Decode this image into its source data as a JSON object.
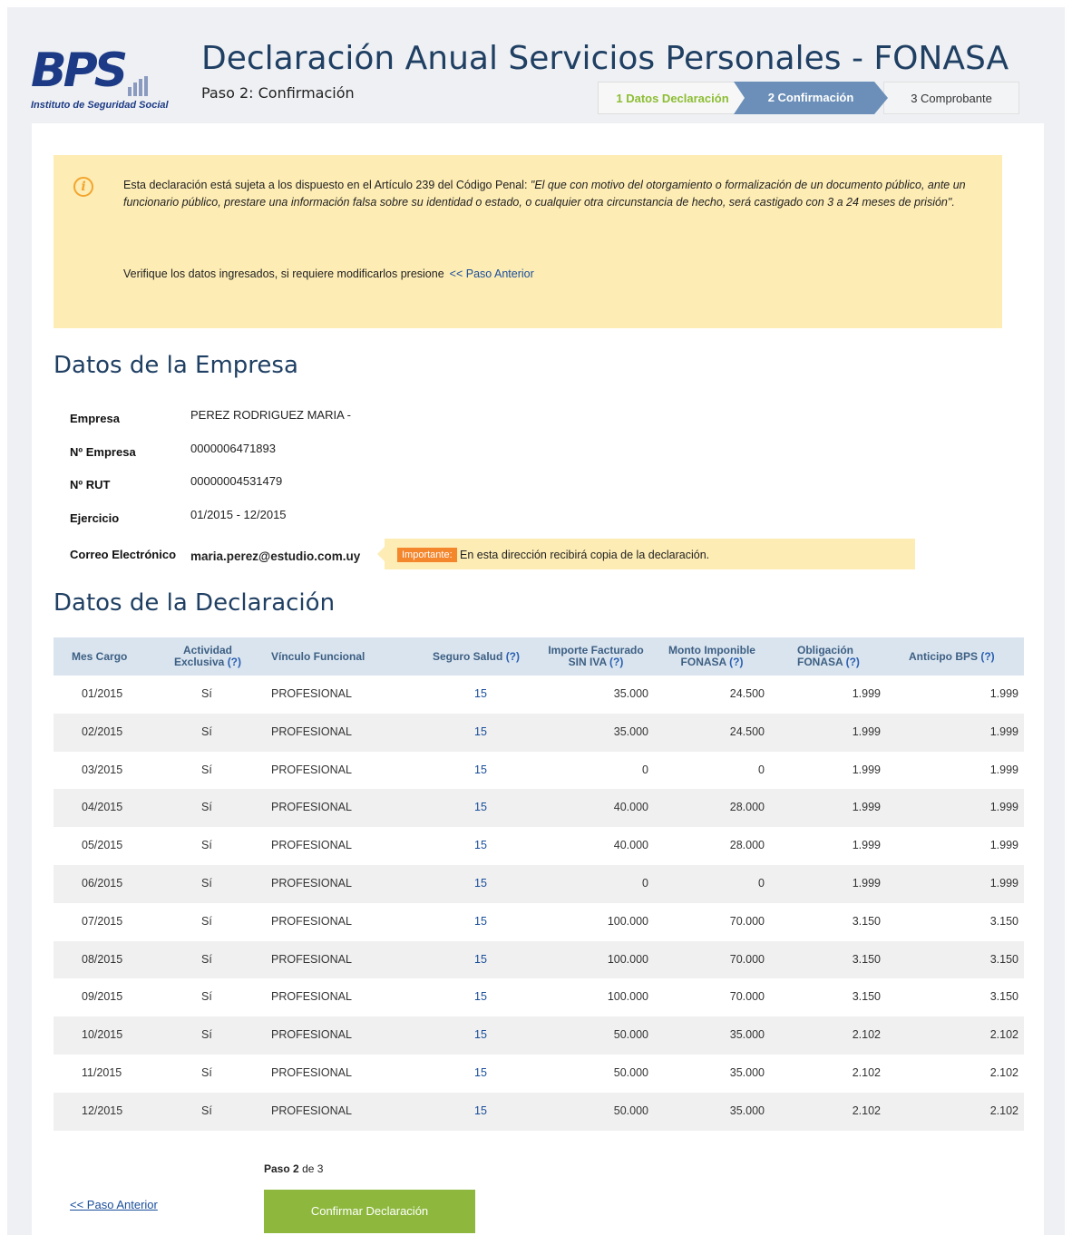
{
  "header": {
    "logo_text": "BPS",
    "logo_caption": "Instituto de Seguridad Social",
    "title": "Declaración Anual Servicios Personales - FONASA",
    "subtitle": "Paso 2: Confirmación",
    "steps": [
      "1 Datos Declaración",
      "2 Confirmación",
      "3 Comprobante"
    ]
  },
  "notice": {
    "text_prefix": "Esta declaración está sujeta a los dispuesto en el Artículo 239 del Código Penal: ",
    "text_quote": "\"El que con motivo del otorgamiento o formalización de un documento público, ante un funcionario público, prestare una información falsa sobre su identidad o estado, o cualquier otra circunstancia de hecho, será castigado con 3 a 24 meses de prisión\".",
    "verify_text": "Verifique los datos ingresados, si requiere modificarlos presione",
    "verify_link": "<< Paso Anterior"
  },
  "empresa": {
    "heading": "Datos de la Empresa",
    "empresa_label": "Empresa",
    "empresa_value": "PEREZ RODRIGUEZ MARIA -",
    "nro_empresa_label": "Nº Empresa",
    "nro_empresa_value": "0000006471893",
    "rut_label": "Nº RUT",
    "rut_value": "00000004531479",
    "ejercicio_label": "Ejercicio",
    "ejercicio_value": "01/2015 - 12/2015",
    "correo_label": "Correo Electrónico",
    "correo_value": "maria.perez@estudio.com.uy",
    "important_badge": "Importante:",
    "important_text": "En esta dirección recibirá copia de la declaración."
  },
  "declaracion": {
    "heading": "Datos de la Declaración",
    "columns": {
      "mes": "Mes Cargo",
      "act1": "Actividad",
      "act2": "Exclusiva",
      "vin": "Vínculo Funcional",
      "seg": "Seguro Salud",
      "imp1": "Importe Facturado",
      "imp2": "SIN IVA",
      "mon1": "Monto Imponible",
      "mon2": "FONASA",
      "obl1": "Obligación",
      "obl2": "FONASA",
      "ant": "Anticipo BPS",
      "help": "(?)"
    },
    "rows": [
      [
        "01/2015",
        "Sí",
        "PROFESIONAL",
        "15",
        "35.000",
        "24.500",
        "1.999",
        "1.999"
      ],
      [
        "02/2015",
        "Sí",
        "PROFESIONAL",
        "15",
        "35.000",
        "24.500",
        "1.999",
        "1.999"
      ],
      [
        "03/2015",
        "Sí",
        "PROFESIONAL",
        "15",
        "0",
        "0",
        "1.999",
        "1.999"
      ],
      [
        "04/2015",
        "Sí",
        "PROFESIONAL",
        "15",
        "40.000",
        "28.000",
        "1.999",
        "1.999"
      ],
      [
        "05/2015",
        "Sí",
        "PROFESIONAL",
        "15",
        "40.000",
        "28.000",
        "1.999",
        "1.999"
      ],
      [
        "06/2015",
        "Sí",
        "PROFESIONAL",
        "15",
        "0",
        "0",
        "1.999",
        "1.999"
      ],
      [
        "07/2015",
        "Sí",
        "PROFESIONAL",
        "15",
        "100.000",
        "70.000",
        "3.150",
        "3.150"
      ],
      [
        "08/2015",
        "Sí",
        "PROFESIONAL",
        "15",
        "100.000",
        "70.000",
        "3.150",
        "3.150"
      ],
      [
        "09/2015",
        "Sí",
        "PROFESIONAL",
        "15",
        "100.000",
        "70.000",
        "3.150",
        "3.150"
      ],
      [
        "10/2015",
        "Sí",
        "PROFESIONAL",
        "15",
        "50.000",
        "35.000",
        "2.102",
        "2.102"
      ],
      [
        "11/2015",
        "Sí",
        "PROFESIONAL",
        "15",
        "50.000",
        "35.000",
        "2.102",
        "2.102"
      ],
      [
        "12/2015",
        "Sí",
        "PROFESIONAL",
        "15",
        "50.000",
        "35.000",
        "2.102",
        "2.102"
      ]
    ]
  },
  "footer": {
    "step_prefix": "Paso",
    "step_current": "2",
    "step_suffix": "de 3",
    "prev_link": "<< Paso Anterior",
    "confirm_button": "Confirmar Declaración"
  },
  "colors": {
    "brand_blue": "#1c3a85",
    "step_active": "#6b8fb8",
    "notice_bg": "#fdecb4",
    "confirm_green": "#8db83d",
    "important_orange": "#f4862c"
  }
}
